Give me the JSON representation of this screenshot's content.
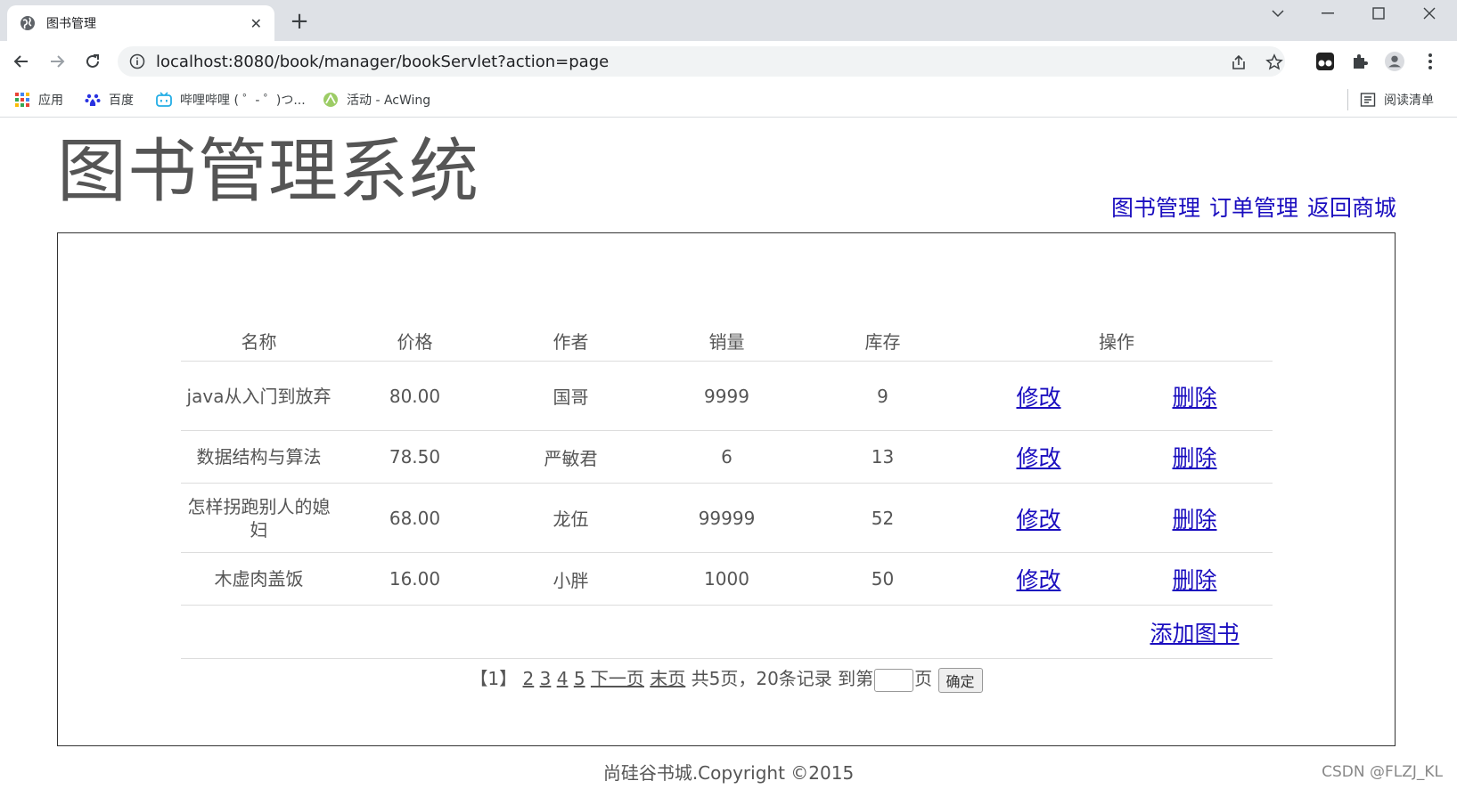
{
  "browser": {
    "tab_title": "图书管理",
    "url": "localhost:8080/book/manager/bookServlet?action=page",
    "bookmarks": [
      {
        "label": "应用",
        "icon": "apps-grid-icon"
      },
      {
        "label": "百度",
        "icon": "baidu-paw-icon"
      },
      {
        "label": "哔哩哔哩 ( ゜- ゜)つ...",
        "icon": "bilibili-tv-icon"
      },
      {
        "label": "活动 - AcWing",
        "icon": "acwing-icon"
      }
    ],
    "reading_list": "阅读清单"
  },
  "header": {
    "title": "图书管理系统",
    "links": [
      "图书管理",
      "订单管理",
      "返回商城"
    ]
  },
  "table": {
    "columns": [
      "名称",
      "价格",
      "作者",
      "销量",
      "库存",
      "操作"
    ],
    "rows": [
      {
        "name": "java从入门到放弃",
        "price": "80.00",
        "author": "国哥",
        "sales": "9999",
        "stock": "9"
      },
      {
        "name": "数据结构与算法",
        "price": "78.50",
        "author": "严敏君",
        "sales": "6",
        "stock": "13"
      },
      {
        "name": "怎样拐跑别人的媳妇",
        "price": "68.00",
        "author": "龙伍",
        "sales": "99999",
        "stock": "52"
      },
      {
        "name": "木虚肉盖饭",
        "price": "16.00",
        "author": "小胖",
        "sales": "1000",
        "stock": "50"
      }
    ],
    "edit_label": "修改",
    "delete_label": "删除",
    "add_label": "添加图书"
  },
  "pager": {
    "current": "【1】",
    "pages": [
      "2",
      "3",
      "4",
      "5"
    ],
    "next": "下一页",
    "last": "末页",
    "summary": "共5页，20条记录",
    "goto_prefix": "到第",
    "goto_suffix": "页",
    "confirm": "确定"
  },
  "footer": "尚硅谷书城.Copyright ©2015",
  "watermark": "CSDN @FLZJ_KL",
  "colors": {
    "link": "#1a0dbf",
    "text": "#555555"
  }
}
